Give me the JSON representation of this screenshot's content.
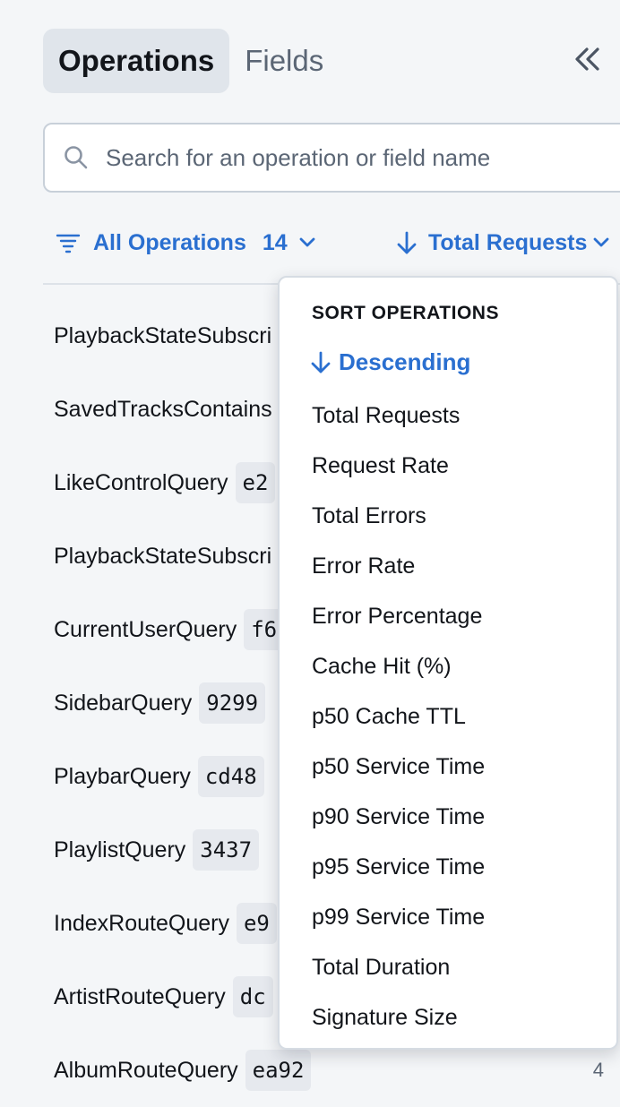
{
  "tabs": [
    {
      "label": "Operations",
      "active": true
    },
    {
      "label": "Fields",
      "active": false
    }
  ],
  "search": {
    "placeholder": "Search for an operation or field name",
    "value": ""
  },
  "filter": {
    "label": "All Operations",
    "count": "14"
  },
  "sort": {
    "label": "Total Requests"
  },
  "operations": [
    {
      "name": "PlaybackStateSubscri",
      "signature": ""
    },
    {
      "name": "SavedTracksContains",
      "signature": ""
    },
    {
      "name": "LikeControlQuery",
      "signature": "e2"
    },
    {
      "name": "PlaybackStateSubscri",
      "signature": ""
    },
    {
      "name": "CurrentUserQuery",
      "signature": "f6"
    },
    {
      "name": "SidebarQuery",
      "signature": "9299"
    },
    {
      "name": "PlaybarQuery",
      "signature": "cd48"
    },
    {
      "name": "PlaylistQuery",
      "signature": "3437"
    },
    {
      "name": "IndexRouteQuery",
      "signature": "e9"
    },
    {
      "name": "ArtistRouteQuery",
      "signature": "dc"
    },
    {
      "name": "AlbumRouteQuery",
      "signature": "ea92",
      "value": "4"
    }
  ],
  "dropdown": {
    "header": "SORT OPERATIONS",
    "direction": "Descending",
    "items": [
      "Total Requests",
      "Request Rate",
      "Total Errors",
      "Error Rate",
      "Error Percentage",
      "Cache Hit (%)",
      "p50 Cache TTL",
      "p50 Service Time",
      "p90 Service Time",
      "p95 Service Time",
      "p99 Service Time",
      "Total Duration",
      "Signature Size"
    ]
  },
  "colors": {
    "accent": "#2a6fd0",
    "background": "#f4f6f8",
    "active_tab": "#e0e5eb"
  },
  "icons": {
    "collapse": "double-chevron-left-icon",
    "search": "search-icon",
    "filter": "filter-lines-icon",
    "sort_direction": "arrow-down-icon",
    "dropdown": "chevron-down-icon"
  }
}
